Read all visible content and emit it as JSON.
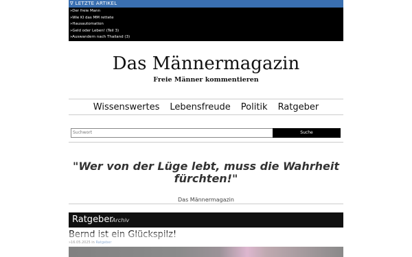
{
  "recent": {
    "heading": "∇ LETZTE ARTIKEL",
    "items": [
      "»Der freie Mann",
      "»Wie KI das MM rettete",
      "»Hausautomation",
      "»Geld oder Leben! (Teil 3)",
      "»Auswandern nach Thailand (3)"
    ]
  },
  "header": {
    "title": "Das Männermagazin",
    "subtitle": "Freie Männer kommentieren"
  },
  "nav": {
    "items": [
      "Wissenswertes",
      "Lebensfreude",
      "Politik",
      "Ratgeber"
    ]
  },
  "search": {
    "placeholder": "Suchwort",
    "button": "Suche"
  },
  "quote": {
    "text": "\"Wer von der Lüge lebt, muss die Wahrheit fürchten!\"",
    "author": "Das Männermagazin"
  },
  "section": {
    "title": "Ratgeber",
    "archive": "Archiv"
  },
  "article": {
    "title": "Bernd ist ein Glückspilz!",
    "date": "»16.05.2025",
    "in": "in",
    "category": "Ratgeber"
  },
  "colors": {
    "accent": "#3a6fb0",
    "dark": "#111111"
  }
}
